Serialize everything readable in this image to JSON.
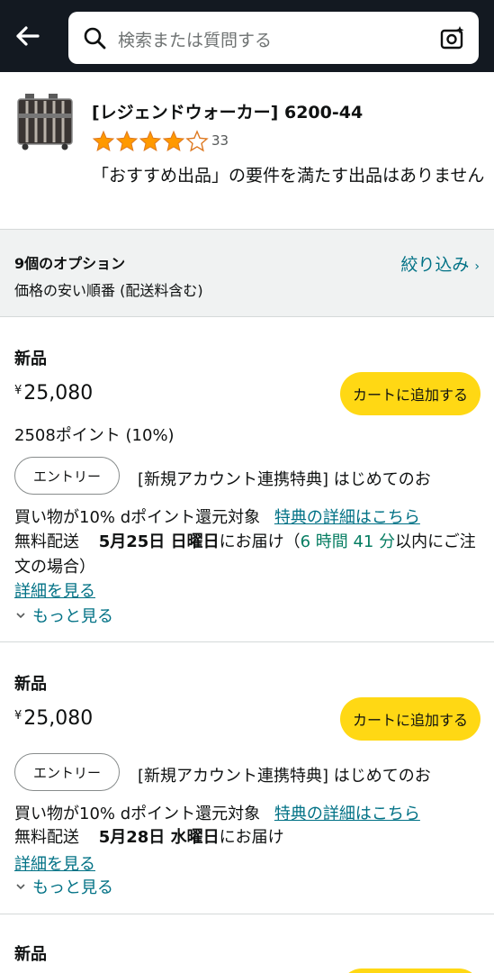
{
  "header": {
    "search_placeholder": "検索または質問する"
  },
  "product": {
    "title": "[レジェンドウォーカー] 6200-44",
    "rating": 4.0,
    "rating_count": "33",
    "notice": "「おすすめ出品」の要件を満たす出品はありません"
  },
  "options": {
    "count_label": "9個のオプション",
    "sort_label": "価格の安い順番 (配送料含む)",
    "filter_label": "絞り込み"
  },
  "offers": [
    {
      "condition": "新品",
      "currency": "¥",
      "price": "25,080",
      "add_to_cart": "カートに追加する",
      "points": "2508ポイント (10%)",
      "entry_button": "エントリー",
      "promo_line1": "[新規アカウント連携特典] はじめてのお",
      "promo_line2": "買い物が10% dポイント還元対象",
      "promo_link": "特典の詳細はこちら",
      "shipping": "無料配送",
      "delivery_date": "5月25日 日曜日",
      "delivery_suffix": "にお届け（",
      "countdown": "6 時間 41 分",
      "delivery_tail": "以内にご注文の場合）",
      "details_link": "詳細を見る",
      "more_link": "もっと見る"
    },
    {
      "condition": "新品",
      "currency": "¥",
      "price": "25,080",
      "add_to_cart": "カートに追加する",
      "entry_button": "エントリー",
      "promo_line1": "[新規アカウント連携特典] はじめてのお",
      "promo_line2": "買い物が10% dポイント還元対象",
      "promo_link": "特典の詳細はこちら",
      "shipping": "無料配送",
      "delivery_date": "5月28日 水曜日",
      "delivery_suffix": "にお届け",
      "details_link": "詳細を見る",
      "more_link": "もっと見る"
    },
    {
      "condition": "新品"
    }
  ],
  "colors": {
    "header_bg": "#131921",
    "star": "#ff9900",
    "link": "#007185",
    "cart_button": "#ffd814",
    "countdown": "#067d62"
  }
}
